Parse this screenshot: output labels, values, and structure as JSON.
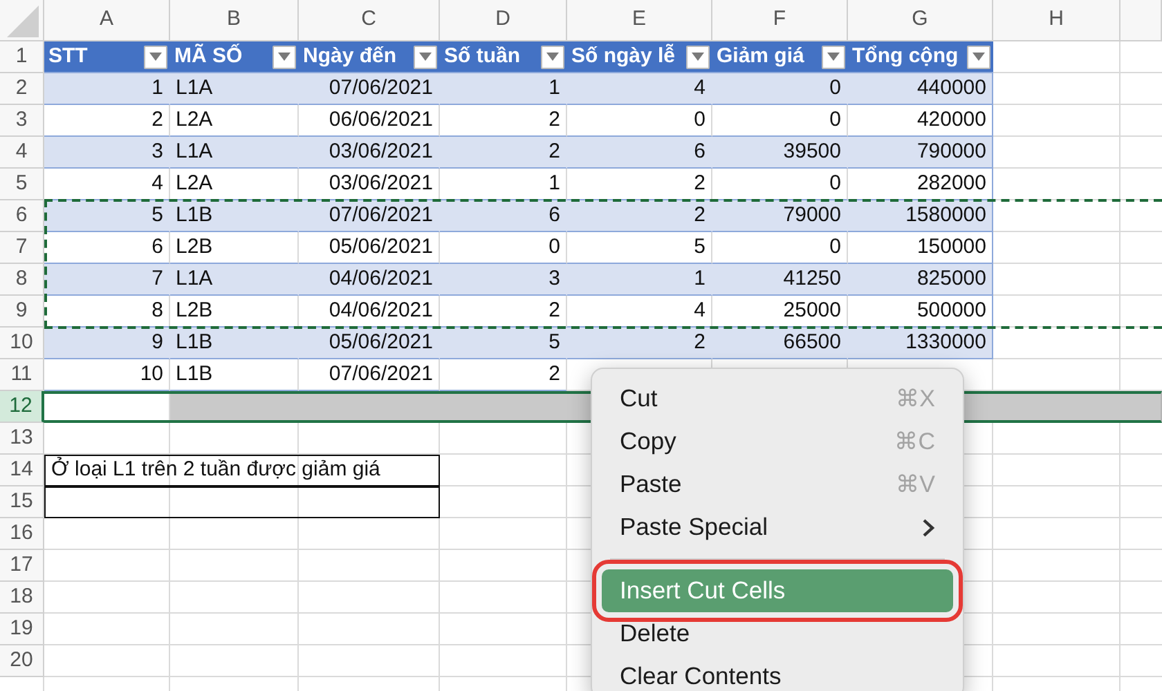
{
  "column_headers": [
    "A",
    "B",
    "C",
    "D",
    "E",
    "F",
    "G",
    "H"
  ],
  "rows": [
    {
      "number": "1",
      "kind": "table-header",
      "selected": false,
      "cells": [
        "STT",
        "MÃ SỐ",
        "Ngày đến",
        "Số tuần",
        "Số ngày lễ",
        "Giảm giá",
        "Tổng cộng"
      ]
    },
    {
      "number": "2",
      "kind": "table-row",
      "selected": false,
      "cut": false,
      "cells": [
        "1",
        "L1A",
        "07/06/2021",
        "1",
        "4",
        "0",
        "440000"
      ]
    },
    {
      "number": "3",
      "kind": "table-row",
      "selected": false,
      "cut": false,
      "cells": [
        "2",
        "L2A",
        "06/06/2021",
        "2",
        "0",
        "0",
        "420000"
      ]
    },
    {
      "number": "4",
      "kind": "table-row",
      "selected": false,
      "cut": false,
      "cells": [
        "3",
        "L1A",
        "03/06/2021",
        "2",
        "6",
        "39500",
        "790000"
      ]
    },
    {
      "number": "5",
      "kind": "table-row",
      "selected": false,
      "cut": false,
      "cells": [
        "4",
        "L2A",
        "03/06/2021",
        "1",
        "2",
        "0",
        "282000"
      ]
    },
    {
      "number": "6",
      "kind": "table-row",
      "selected": false,
      "cut": true,
      "cells": [
        "5",
        "L1B",
        "07/06/2021",
        "6",
        "2",
        "79000",
        "1580000"
      ]
    },
    {
      "number": "7",
      "kind": "table-row",
      "selected": false,
      "cut": true,
      "cells": [
        "6",
        "L2B",
        "05/06/2021",
        "0",
        "5",
        "0",
        "150000"
      ]
    },
    {
      "number": "8",
      "kind": "table-row",
      "selected": false,
      "cut": true,
      "cells": [
        "7",
        "L1A",
        "04/06/2021",
        "3",
        "1",
        "41250",
        "825000"
      ]
    },
    {
      "number": "9",
      "kind": "table-row",
      "selected": false,
      "cut": true,
      "cells": [
        "8",
        "L2B",
        "04/06/2021",
        "2",
        "4",
        "25000",
        "500000"
      ]
    },
    {
      "number": "10",
      "kind": "table-row",
      "selected": false,
      "cut": false,
      "cells": [
        "9",
        "L1B",
        "05/06/2021",
        "5",
        "2",
        "66500",
        "1330000"
      ]
    },
    {
      "number": "11",
      "kind": "table-row",
      "selected": false,
      "cut": false,
      "cells": [
        "10",
        "L1B",
        "07/06/2021",
        "2"
      ]
    },
    {
      "number": "12",
      "kind": "blank",
      "selected": true
    },
    {
      "number": "13",
      "kind": "blank",
      "selected": false
    },
    {
      "number": "14",
      "kind": "note",
      "selected": false,
      "text": "Ở loại L1 trên 2 tuần được giảm giá"
    },
    {
      "number": "15",
      "kind": "note-blank",
      "selected": false
    },
    {
      "number": "16",
      "kind": "blank",
      "selected": false
    },
    {
      "number": "17",
      "kind": "blank",
      "selected": false
    },
    {
      "number": "18",
      "kind": "blank",
      "selected": false
    },
    {
      "number": "19",
      "kind": "blank",
      "selected": false
    },
    {
      "number": "20",
      "kind": "blank",
      "selected": false
    }
  ],
  "context_menu": {
    "items": [
      {
        "kind": "command",
        "label": "Cut",
        "shortcut": "⌘X",
        "selected": false,
        "outlined": false
      },
      {
        "kind": "command",
        "label": "Copy",
        "shortcut": "⌘C",
        "selected": false,
        "outlined": false
      },
      {
        "kind": "command",
        "label": "Paste",
        "shortcut": "⌘V",
        "selected": false,
        "outlined": false
      },
      {
        "kind": "submenu",
        "label": "Paste Special",
        "selected": false,
        "outlined": false
      },
      {
        "kind": "separator"
      },
      {
        "kind": "command",
        "label": "Insert Cut Cells",
        "selected": true,
        "outlined": true
      },
      {
        "kind": "command",
        "label": "Delete",
        "selected": false,
        "outlined": false
      },
      {
        "kind": "command",
        "label": "Clear Contents",
        "selected": false,
        "outlined": false
      }
    ]
  }
}
